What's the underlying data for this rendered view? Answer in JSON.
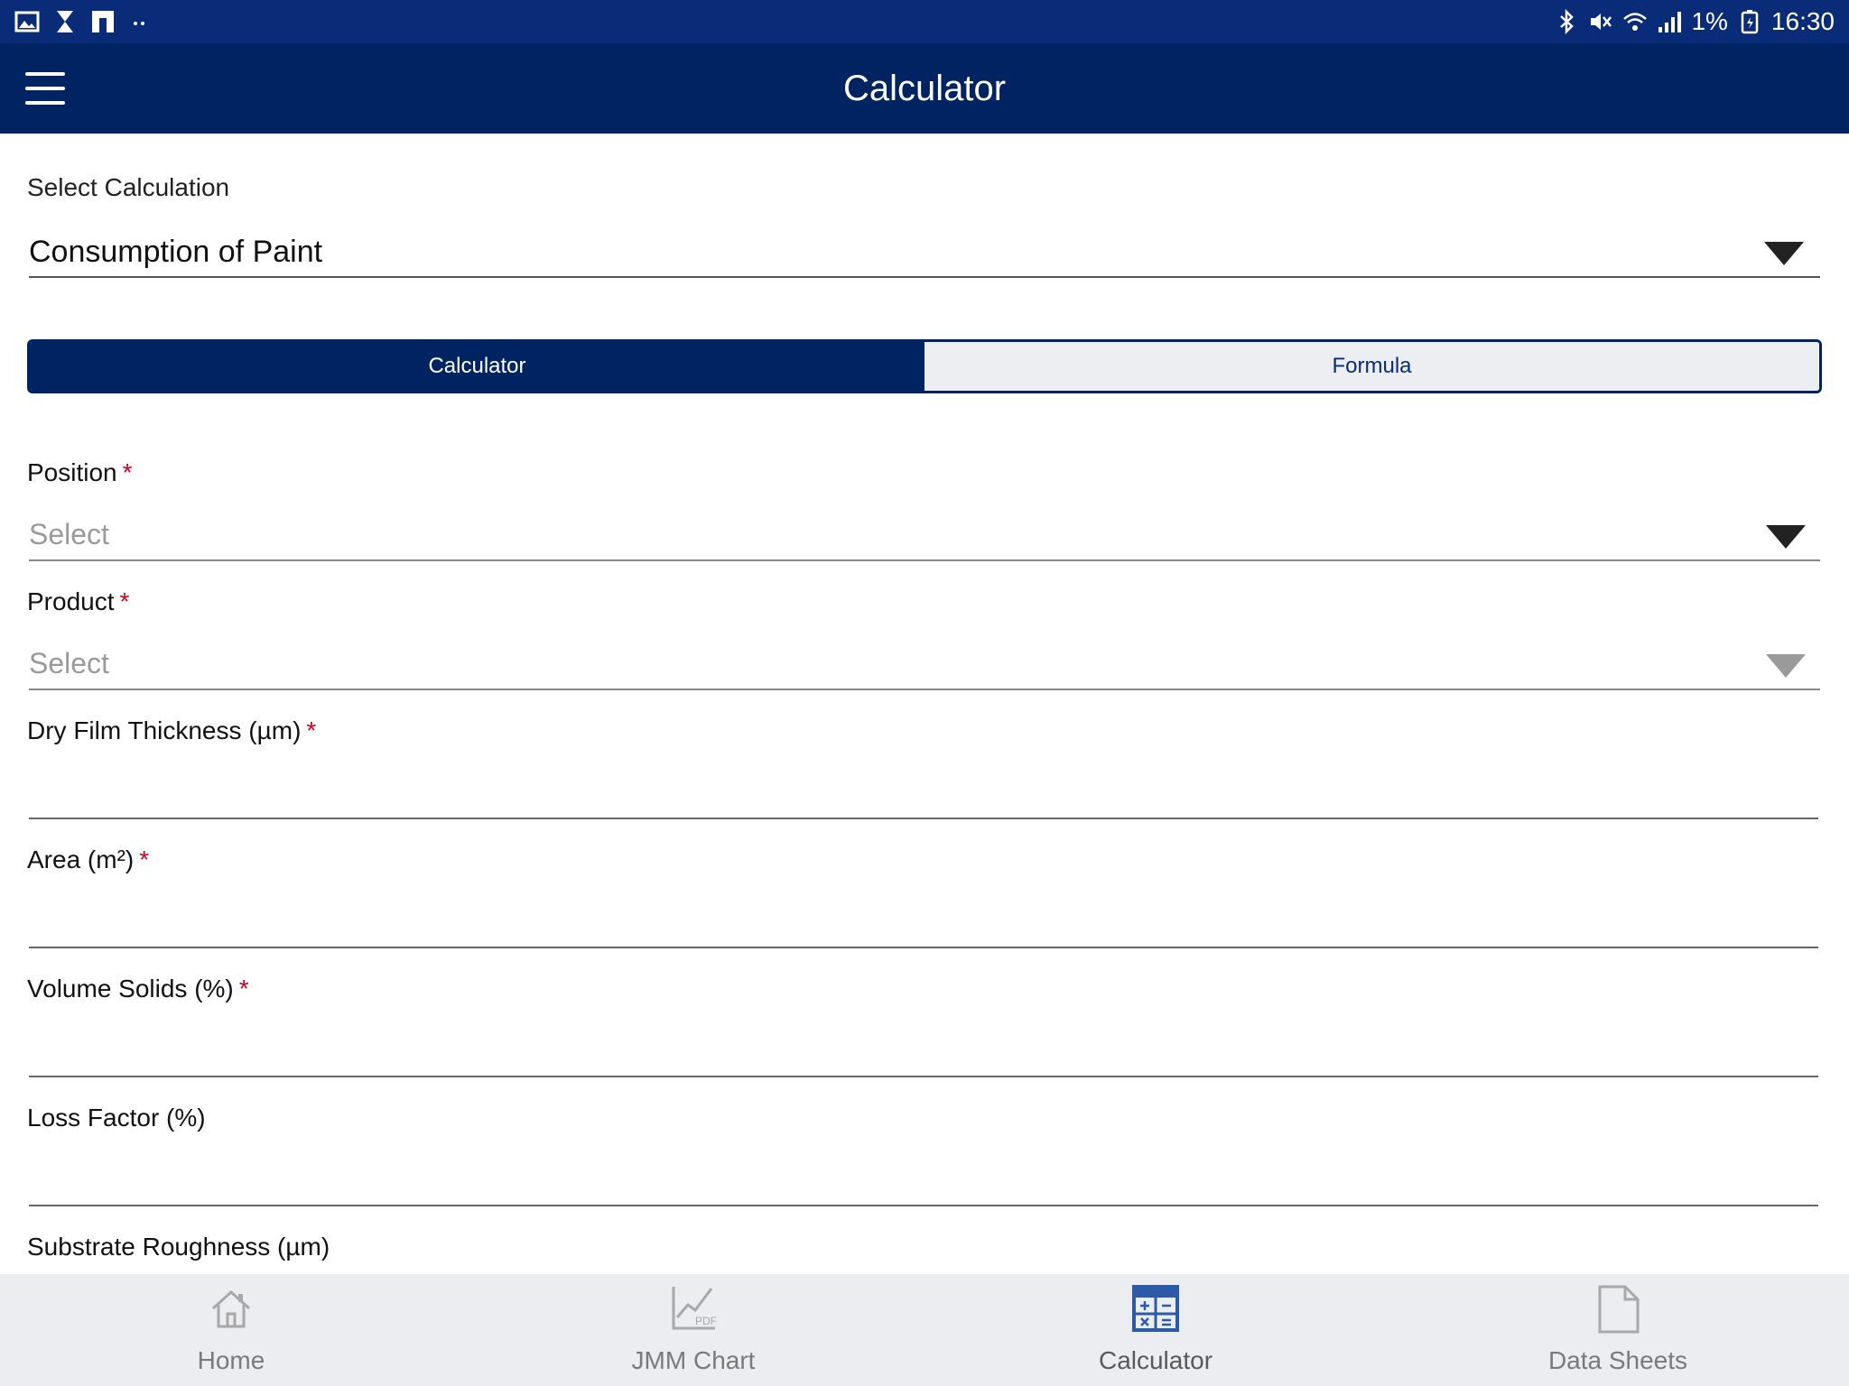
{
  "status_bar": {
    "battery": "1%",
    "time": "16:30"
  },
  "app_bar": {
    "title": "Calculator"
  },
  "calculation": {
    "label": "Select Calculation",
    "value": "Consumption of Paint"
  },
  "tabs": [
    {
      "label": "Calculator",
      "active": true
    },
    {
      "label": "Formula",
      "active": false
    }
  ],
  "form": {
    "required_mark": "*",
    "position": {
      "label": "Position",
      "placeholder": "Select"
    },
    "product": {
      "label": "Product",
      "placeholder": "Select"
    },
    "dft": {
      "label": "Dry Film Thickness (µm)",
      "value": ""
    },
    "area": {
      "label": "Area (m²)",
      "value": ""
    },
    "volume_solids": {
      "label": "Volume Solids (%)",
      "value": ""
    },
    "loss_factor": {
      "label": "Loss Factor (%)",
      "value": ""
    },
    "substrate_roughness": {
      "label": "Substrate Roughness (µm)"
    }
  },
  "bottom_nav": [
    {
      "label": "Home",
      "icon": "home-icon"
    },
    {
      "label": "JMM Chart",
      "icon": "chart-pdf-icon",
      "icon_text": "PDF"
    },
    {
      "label": "Calculator",
      "icon": "calculator-icon",
      "active": true
    },
    {
      "label": "Data Sheets",
      "icon": "document-icon"
    }
  ],
  "colors": {
    "status_bar": "#0a2c78",
    "app_bar": "#002462",
    "required": "#d0021b",
    "nav_active_icon": "#2d5aa8"
  }
}
